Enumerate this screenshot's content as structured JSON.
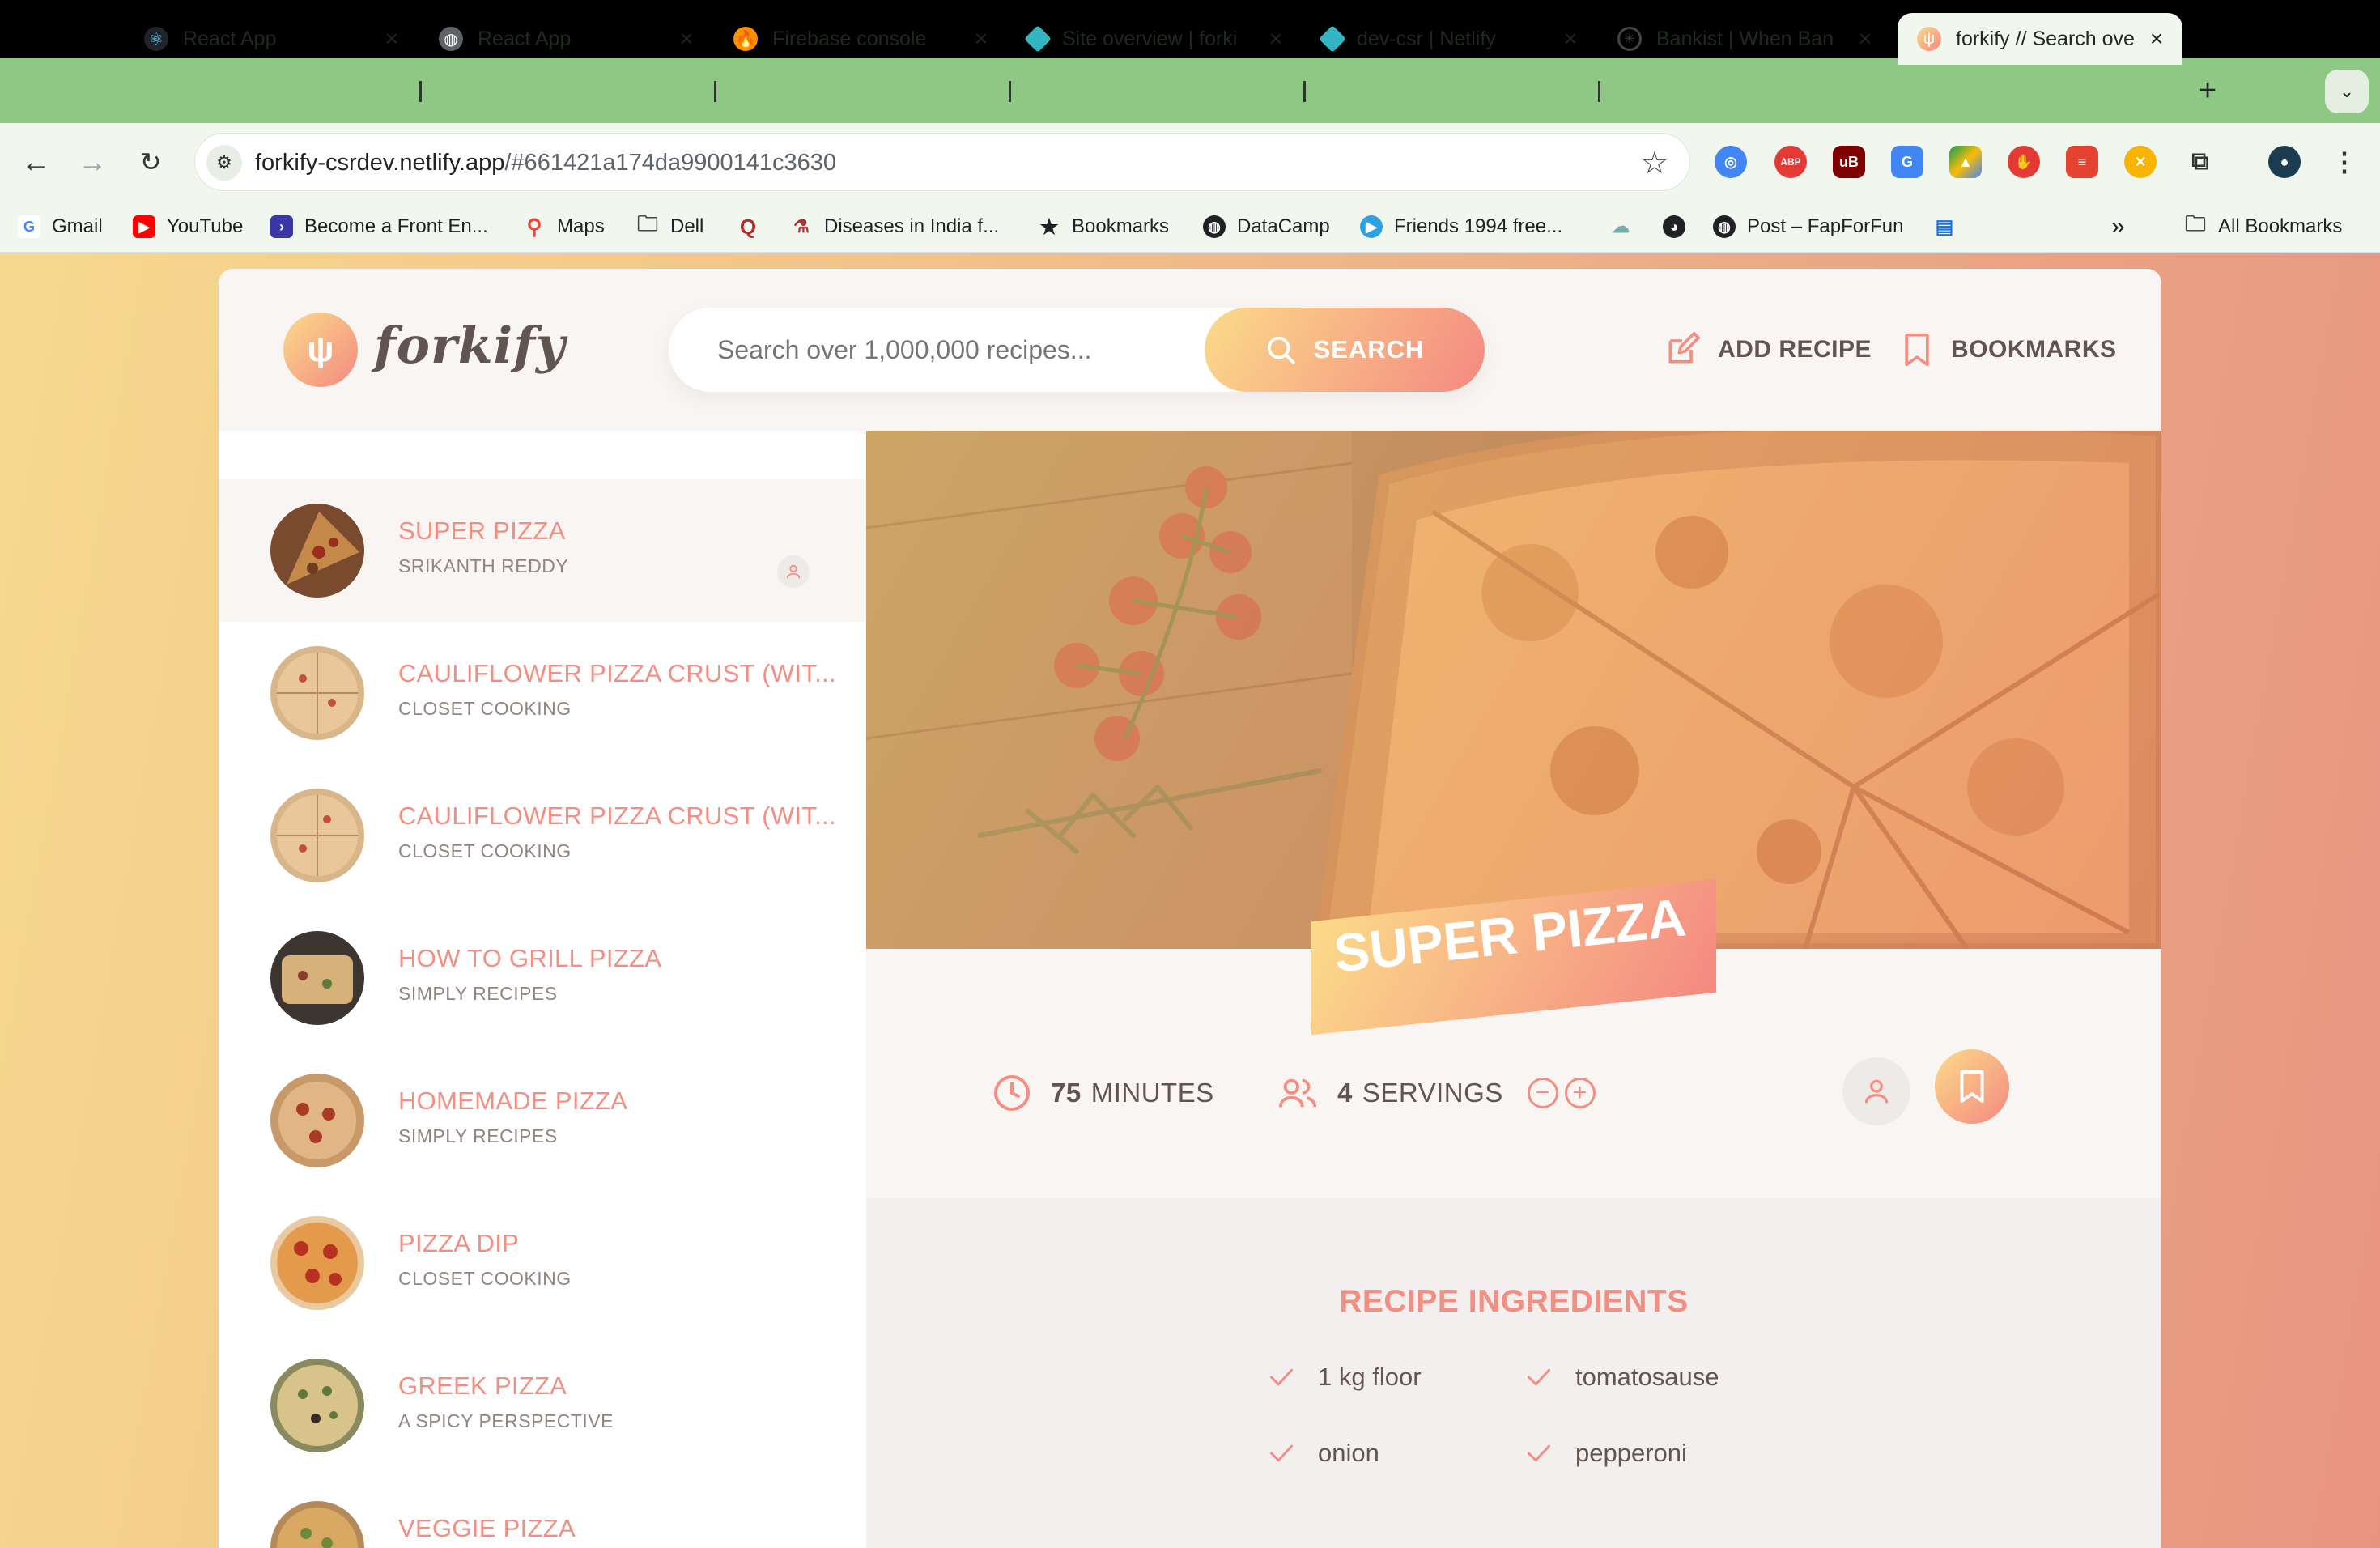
{
  "browser": {
    "tabs": [
      {
        "label": "React App",
        "icon": "react-icon"
      },
      {
        "label": "React App",
        "icon": "globe-icon"
      },
      {
        "label": "Firebase console",
        "icon": "firebase-icon"
      },
      {
        "label": "Site overview | forki",
        "icon": "netlify-icon"
      },
      {
        "label": "dev-csr | Netlify",
        "icon": "netlify-icon"
      },
      {
        "label": "Bankist | When Ban",
        "icon": "bankist-icon"
      },
      {
        "label": "forkify // Search ove",
        "icon": "forkify-icon",
        "active": true
      }
    ],
    "url_host": "forkify-csrdev.netlify.app",
    "url_path": "/#661421a174da9900141c3630",
    "bookmarks": [
      {
        "label": "Gmail",
        "icon": "google-icon"
      },
      {
        "label": "YouTube",
        "icon": "youtube-icon"
      },
      {
        "label": "Become a Front En...",
        "icon": "terminal-icon"
      },
      {
        "label": "Maps",
        "icon": "maps-pin-icon"
      },
      {
        "label": "Dell",
        "icon": "folder-icon"
      },
      {
        "label": "Diseases in India f...",
        "icon": "page-icon"
      },
      {
        "label": "Bookmarks",
        "icon": "star-icon"
      },
      {
        "label": "DataCamp",
        "icon": "globe-icon"
      },
      {
        "label": "Friends 1994 free...",
        "icon": "play-icon"
      },
      {
        "label": "Post – FapForFun",
        "icon": "globe-icon"
      },
      {
        "label": "All Bookmarks",
        "icon": "folder-icon"
      }
    ]
  },
  "app": {
    "logo_text": "forkify",
    "search": {
      "placeholder": "Search over 1,000,000 recipes...",
      "button": "SEARCH"
    },
    "nav": {
      "add_recipe": "ADD RECIPE",
      "bookmarks": "BOOKMARKS"
    },
    "results": [
      {
        "title": "SUPER PIZZA",
        "publisher": "SRIKANTH REDDY",
        "user_generated": true,
        "active": true
      },
      {
        "title": "CAULIFLOWER PIZZA CRUST (WIT...",
        "publisher": "CLOSET COOKING"
      },
      {
        "title": "CAULIFLOWER PIZZA CRUST (WIT...",
        "publisher": "CLOSET COOKING"
      },
      {
        "title": "HOW TO GRILL PIZZA",
        "publisher": "SIMPLY RECIPES"
      },
      {
        "title": "HOMEMADE PIZZA",
        "publisher": "SIMPLY RECIPES"
      },
      {
        "title": "PIZZA DIP",
        "publisher": "CLOSET COOKING"
      },
      {
        "title": "GREEK PIZZA",
        "publisher": "A SPICY PERSPECTIVE"
      },
      {
        "title": "VEGGIE PIZZA",
        "publisher": ""
      }
    ],
    "recipe": {
      "title": "SUPER PIZZA",
      "minutes": "75",
      "minutes_label": "MINUTES",
      "servings": "4",
      "servings_label": "SERVINGS",
      "decrease": "−",
      "increase": "+",
      "ingredients_heading": "RECIPE INGREDIENTS",
      "ingredients": [
        "1 kg floor",
        "tomatosause",
        "onion",
        "pepperoni"
      ]
    }
  },
  "colors": {
    "accent": "#f38e82",
    "gradient_start": "#fbdb89",
    "gradient_end": "#f48982",
    "text": "#615551",
    "tabstrip": "#8fc785"
  }
}
